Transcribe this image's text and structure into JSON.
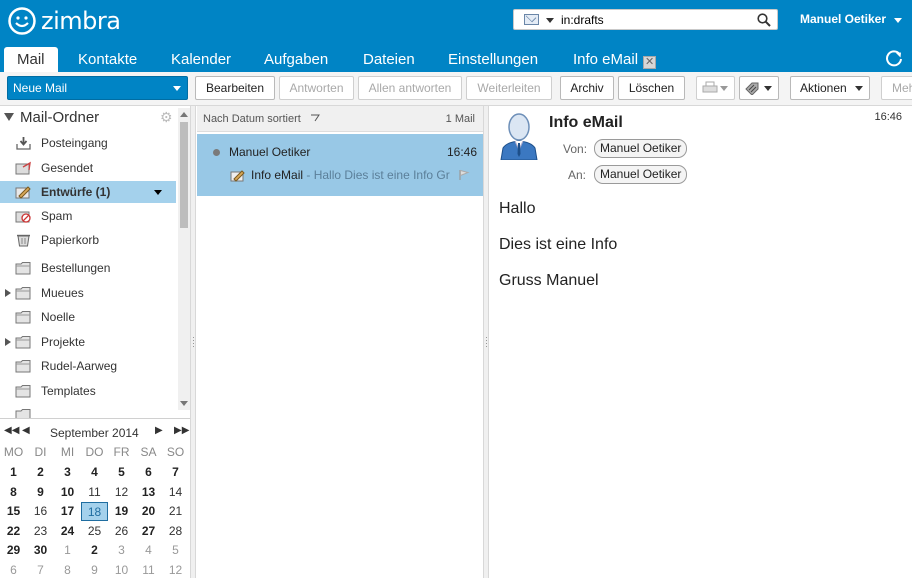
{
  "header": {
    "logo_text": "zimbra",
    "search_query": "in:drafts",
    "user_name": "Manuel Oetiker",
    "brand_color": "#0084c5"
  },
  "tabs": [
    {
      "label": "Mail",
      "active": true
    },
    {
      "label": "Kontakte"
    },
    {
      "label": "Kalender"
    },
    {
      "label": "Aufgaben"
    },
    {
      "label": "Dateien"
    },
    {
      "label": "Einstellungen"
    },
    {
      "label": "Info eMail",
      "closable": true
    }
  ],
  "tab_close_glyph": "✕",
  "toolbar": {
    "new_mail": "Neue Mail",
    "edit": "Bearbeiten",
    "reply": "Antworten",
    "reply_all": "Allen antworten",
    "forward": "Weiterleiten",
    "archive": "Archiv",
    "delete": "Löschen",
    "actions": "Aktionen",
    "more": "Meh"
  },
  "folders": {
    "header": "Mail-Ordner",
    "items": [
      {
        "label": "Posteingang",
        "icon": "inbox-icon"
      },
      {
        "label": "Gesendet",
        "icon": "sent-icon"
      },
      {
        "label": "Entwürfe (1)",
        "icon": "drafts-icon",
        "selected": true
      },
      {
        "label": "Spam",
        "icon": "spam-icon"
      },
      {
        "label": "Papierkorb",
        "icon": "trash-icon"
      },
      {
        "label": "Bestellungen",
        "icon": "folder-icon"
      },
      {
        "label": "Mueues",
        "icon": "folder-icon",
        "expandable": true
      },
      {
        "label": "Noelle",
        "icon": "folder-icon"
      },
      {
        "label": "Projekte",
        "icon": "folder-icon",
        "expandable": true
      },
      {
        "label": "Rudel-Aarweg",
        "icon": "folder-icon"
      },
      {
        "label": "Templates",
        "icon": "folder-icon"
      }
    ]
  },
  "calendar": {
    "title": "September 2014",
    "weekdays": [
      "MO",
      "DI",
      "MI",
      "DO",
      "FR",
      "SA",
      "SO"
    ],
    "weeks": [
      [
        "1",
        "2",
        "3",
        "4",
        "5",
        "6",
        "7"
      ],
      [
        "8",
        "9",
        "10",
        "11",
        "12",
        "13",
        "14"
      ],
      [
        "15",
        "16",
        "17",
        "18",
        "19",
        "20",
        "21"
      ],
      [
        "22",
        "23",
        "24",
        "25",
        "26",
        "27",
        "28"
      ],
      [
        "29",
        "30",
        "1",
        "2",
        "3",
        "4",
        "5"
      ],
      [
        "6",
        "7",
        "8",
        "9",
        "10",
        "11",
        "12"
      ]
    ],
    "today": "18"
  },
  "message_list": {
    "sort_label": "Nach Datum sortiert",
    "count": "1 Mail",
    "messages": [
      {
        "from": "Manuel Oetiker",
        "time": "16:46",
        "subject": "Info eMail",
        "fragment": " - Hallo Dies ist eine Info Gr"
      }
    ]
  },
  "reading_pane": {
    "subject": "Info eMail",
    "time": "16:46",
    "from_label": "Von:",
    "from": "Manuel Oetiker",
    "to_label": "An:",
    "to": "Manuel Oetiker",
    "body": [
      "Hallo",
      "Dies ist eine Info",
      "Gruss Manuel"
    ]
  }
}
